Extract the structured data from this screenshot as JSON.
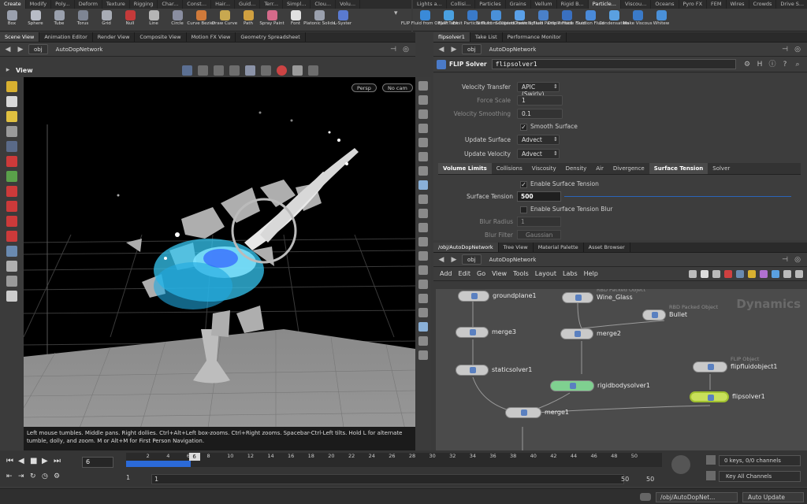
{
  "left_shelf": {
    "tabs": [
      "Create",
      "Modify",
      "Poly...",
      "Deform",
      "Texture",
      "Rigging",
      "Char...",
      "Const...",
      "Hair...",
      "Guid...",
      "Terr...",
      "Simpl...",
      "Clou...",
      "Volu..."
    ],
    "tools": [
      "Box",
      "Sphere",
      "Tube",
      "Torus",
      "Grid",
      "Null",
      "Line",
      "Circle",
      "Curve Bezier",
      "Draw Curve",
      "Path",
      "Spray Paint",
      "Font",
      "Platonic Solids",
      "L-Syster"
    ]
  },
  "right_shelf": {
    "tabs": [
      "Lights a...",
      "Collisi...",
      "Particles",
      "Grains",
      "Vellum",
      "Rigid B...",
      "Particle...",
      "Viscou...",
      "Oceans",
      "Pyro FX",
      "FEM",
      "Wires",
      "Crowds",
      "Drive S..."
    ],
    "tools": [
      "FLIP Fluid from Object",
      "FLIP Tank",
      "Emit Particle Fluid",
      "Sink from Objects",
      "Sculpted Particle Fluid",
      "Crown Splash Particle Fluid",
      "Drip Particle Fluid",
      "Suction Fluid",
      "Condensation",
      "Make Viscous",
      "Whitew"
    ]
  },
  "left_pane": {
    "tabs": [
      "Scene View",
      "Animation Editor",
      "Render View",
      "Composite View",
      "Motion FX View",
      "Geometry Spreadsheet"
    ],
    "path": [
      "obj",
      "AutoDopNetwork"
    ],
    "view_label": "View",
    "persp": "Persp",
    "cam": "No cam",
    "hint": "Left mouse tumbles. Middle pans. Right dollies. Ctrl+Alt+Left box-zooms. Ctrl+Right zooms. Spacebar-Ctrl-Left tilts. Hold L for alternate tumble, dolly, and zoom.     M or Alt+M for First Person Navigation."
  },
  "param_pane": {
    "tabs": [
      "flipsolver1",
      "Take List",
      "Performance Monitor"
    ],
    "path": [
      "obj",
      "AutoDopNetwork"
    ],
    "node_type": "FLIP Solver",
    "node_name": "flipsolver1",
    "rows": [
      {
        "label": "Velocity Transfer",
        "value": "APIC (Swirly)",
        "type": "menu",
        "dim": false
      },
      {
        "label": "Force Scale",
        "value": "1",
        "type": "num",
        "dim": true
      },
      {
        "label": "Velocity Smoothing",
        "value": "0.1",
        "type": "num",
        "dim": true
      },
      {
        "label": "",
        "value": "Smooth Surface",
        "type": "check",
        "dim": false
      },
      {
        "label": "Update Surface",
        "value": "Advect",
        "type": "menu",
        "dim": false
      },
      {
        "label": "Update Velocity",
        "value": "Advect",
        "type": "menu",
        "dim": false
      }
    ],
    "subtabs": [
      "Volume Limits",
      "Collisions",
      "Viscosity",
      "Density",
      "Air",
      "Divergence",
      "Surface Tension",
      "Solver"
    ],
    "active_subtab": "Surface Tension",
    "enable_surface_tension": "Enable Surface Tension",
    "surface_tension_label": "Surface Tension",
    "surface_tension_value": "500",
    "enable_blur": "Enable Surface Tension Blur",
    "blur_radius_label": "Blur Radius",
    "blur_radius_value": "1",
    "blur_filter_label": "Blur Filter",
    "blur_filter_value": "Gaussian"
  },
  "network_pane": {
    "tabs": [
      "/obj/AutoDopNetwork",
      "Tree View",
      "Material Palette",
      "Asset Browser"
    ],
    "path": [
      "obj",
      "AutoDopNetwork"
    ],
    "menu": [
      "Add",
      "Edit",
      "Go",
      "View",
      "Tools",
      "Layout",
      "Labs",
      "Help"
    ],
    "watermark": "Dynamics",
    "nodes": [
      {
        "name": "groundplane1",
        "type": ""
      },
      {
        "name": "Wine_Glass",
        "type": "RBD Packed Object"
      },
      {
        "name": "Bullet",
        "type": "RBD Packed Object"
      },
      {
        "name": "merge3",
        "type": ""
      },
      {
        "name": "merge2",
        "type": ""
      },
      {
        "name": "staticsolver1",
        "type": ""
      },
      {
        "name": "flipfluidobject1",
        "type": "FLIP Object"
      },
      {
        "name": "rigidbodysolver1",
        "type": ""
      },
      {
        "name": "flipsolver1",
        "type": ""
      },
      {
        "name": "merge1",
        "type": ""
      }
    ]
  },
  "timeline": {
    "current_frame": "6",
    "frame_field": "6",
    "ticks": [
      "2",
      "4",
      "6",
      "8",
      "10",
      "12",
      "14",
      "16",
      "18",
      "20",
      "22",
      "24",
      "26",
      "28",
      "30",
      "32",
      "34",
      "36",
      "38",
      "40",
      "42",
      "44",
      "46",
      "48",
      "50"
    ],
    "start": "1",
    "start2": "1",
    "end": "50",
    "end2": "50",
    "playback_progress": 0.12,
    "keys_label": "0 keys, 0/0 channels",
    "key_all": "Key All Channels"
  },
  "statusbar": {
    "path": "/obj/AutoDopNet...",
    "update": "Auto Update"
  },
  "colors": {
    "accent": "#f0c020",
    "fluid": "#3fd0ff",
    "timeline_blue": "#2b6ad8",
    "active_node": "#c8e05a"
  }
}
